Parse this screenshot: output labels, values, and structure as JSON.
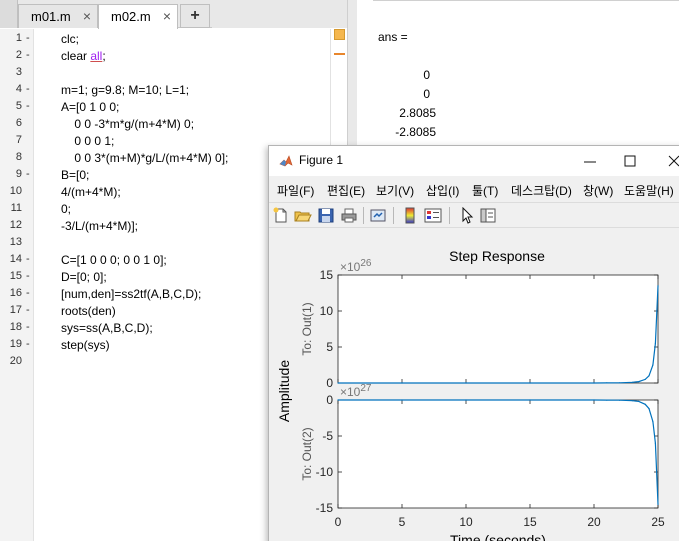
{
  "editor": {
    "tabs": [
      {
        "label": "m01.m",
        "close": "×"
      },
      {
        "label": "m02.m",
        "close": "×"
      }
    ],
    "add_tab": "+",
    "line_numbers": [
      "1",
      "2",
      "3",
      "4",
      "5",
      "6",
      "7",
      "8",
      "9",
      "10",
      "11",
      "12",
      "13",
      "14",
      "15",
      "16",
      "17",
      "18",
      "19",
      "20"
    ],
    "line_markers": [
      "-",
      "-",
      "",
      "-",
      "-",
      "",
      "",
      "",
      "-",
      "",
      "",
      "",
      "",
      "-",
      "-",
      "-",
      "-",
      "-",
      "-",
      ""
    ],
    "code_lines": [
      "clc;",
      "clear ",
      "",
      "m=1; g=9.8; M=10; L=1;",
      "A=[0 1 0 0;",
      "    0 0 -3*m*g/(m+4*M) 0;",
      "    0 0 0 1;",
      "    0 0 3*(m+M)*g/L/(m+4*M) 0];",
      "B=[0;",
      "4/(m+4*M);",
      "0;",
      "-3/L/(m+4*M)];",
      "",
      "C=[1 0 0 0; 0 0 1 0];",
      "D=[0; 0];",
      "[num,den]=ss2tf(A,B,C,D);",
      "roots(den)",
      "sys=ss(A,B,C,D);",
      "step(sys)",
      ""
    ],
    "line2_keyword": "all",
    "line2_tail": ";"
  },
  "command_window": {
    "ans_label": "ans =",
    "values": [
      "0",
      "0",
      "2.8085",
      "-2.8085"
    ]
  },
  "figure": {
    "title": "Figure 1",
    "menu": [
      "파일(F)",
      "편집(E)",
      "보기(V)",
      "삽입(I)",
      "툴(T)",
      "데스크탑(D)",
      "창(W)",
      "도움말(H)"
    ],
    "toolbar_icons": [
      "new-figure-icon",
      "open-file-icon",
      "save-icon",
      "print-icon",
      "link-icon",
      "colorbar-icon",
      "legend-icon",
      "pointer-icon",
      "property-inspector-icon"
    ],
    "colors": {
      "curve": "#0072bd",
      "axes": "#262626",
      "bg": "#f0f0f0"
    }
  },
  "chart_data": {
    "type": "line",
    "title": "Step Response",
    "xlabel": "Time (seconds)",
    "ylabel": "Amplitude",
    "xlim": [
      0,
      25
    ],
    "xticks": [
      "0",
      "5",
      "10",
      "15",
      "20",
      "25"
    ],
    "subplots": [
      {
        "name": "To: Out(1)",
        "exponent": "×10",
        "exponent_power": "26",
        "ylim": [
          0,
          15
        ],
        "yticks": [
          "15",
          "10",
          "5",
          "0"
        ],
        "ytick_values": [
          15,
          10,
          5,
          0
        ],
        "x": [
          0,
          5,
          10,
          15,
          20,
          21,
          22,
          23,
          23.5,
          24,
          24.3,
          24.6,
          24.8,
          25
        ],
        "y": [
          0,
          0,
          0,
          0,
          0,
          0.01,
          0.03,
          0.1,
          0.2,
          0.5,
          1.0,
          2.5,
          5.5,
          13.5
        ]
      },
      {
        "name": "To: Out(2)",
        "exponent": "×10",
        "exponent_power": "27",
        "ylim": [
          -15,
          0
        ],
        "yticks": [
          "0",
          "-5",
          "-10",
          "-15"
        ],
        "ytick_values": [
          0,
          -5,
          -10,
          -15
        ],
        "x": [
          0,
          5,
          10,
          15,
          20,
          21,
          22,
          23,
          23.5,
          24,
          24.3,
          24.6,
          24.8,
          25
        ],
        "y": [
          0,
          0,
          0,
          0,
          0,
          -0.01,
          -0.03,
          -0.1,
          -0.2,
          -0.6,
          -1.2,
          -3.0,
          -6.0,
          -14.5
        ]
      }
    ],
    "grid": false
  }
}
